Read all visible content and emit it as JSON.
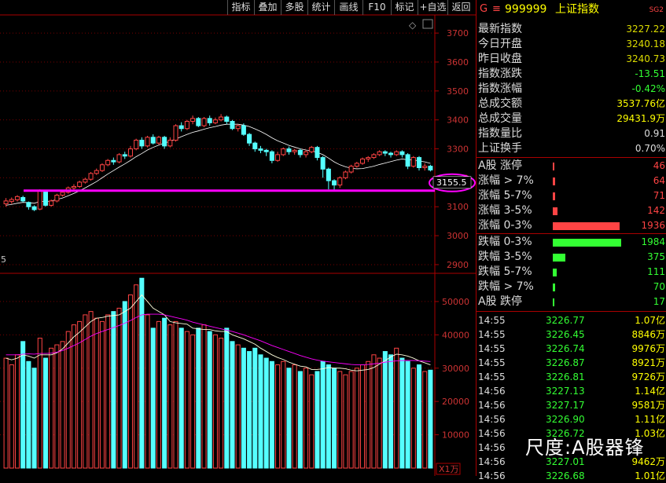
{
  "toolbar": {
    "items": [
      "指标",
      "叠加",
      "多股",
      "统计",
      "画线",
      "F10",
      "标记",
      "+自选",
      "返回"
    ]
  },
  "header": {
    "g_label": "G",
    "menu_icon": "≡",
    "code": "999999",
    "name": "上证指数",
    "badge": "SG2"
  },
  "quote": [
    {
      "label": "最新指数",
      "value": "3227.22",
      "color": "#dd0"
    },
    {
      "label": "今日开盘",
      "value": "3240.18",
      "color": "#dd0"
    },
    {
      "label": "昨日收盘",
      "value": "3240.73",
      "color": "#dd0"
    },
    {
      "label": "指数涨跌",
      "value": "-13.51",
      "color": "#3f3"
    },
    {
      "label": "指数涨幅",
      "value": "-0.42%",
      "color": "#3f3"
    },
    {
      "label": "总成交额",
      "value": "3537.76亿",
      "color": "#ff0"
    },
    {
      "label": "总成交量",
      "value": "29431.9万",
      "color": "#ff0"
    },
    {
      "label": "指数量比",
      "value": "0.91",
      "color": "#ddd"
    },
    {
      "label": "上证换手",
      "value": "0.70%",
      "color": "#ddd"
    }
  ],
  "counts": [
    {
      "label": "A股 涨停",
      "value": "46",
      "frac": 0.012,
      "color": "#f44"
    },
    {
      "label": "涨幅 > 7%",
      "value": "64",
      "frac": 0.016,
      "color": "#f44"
    },
    {
      "label": "涨幅 5-7%",
      "value": "71",
      "frac": 0.018,
      "color": "#f44"
    },
    {
      "label": "涨幅 3-5%",
      "value": "142",
      "frac": 0.036,
      "color": "#f44"
    },
    {
      "label": "涨幅 0-3%",
      "value": "1936",
      "frac": 0.5,
      "color": "#f44"
    },
    {
      "label": "跌幅 0-3%",
      "value": "1984",
      "frac": 0.51,
      "color": "#3f3"
    },
    {
      "label": "跌幅 3-5%",
      "value": "375",
      "frac": 0.096,
      "color": "#3f3"
    },
    {
      "label": "跌幅 5-7%",
      "value": "111",
      "frac": 0.029,
      "color": "#3f3"
    },
    {
      "label": "跌幅 > 7%",
      "value": "70",
      "frac": 0.018,
      "color": "#3f3"
    },
    {
      "label": "A股 跌停",
      "value": "17",
      "frac": 0.004,
      "color": "#3f3"
    }
  ],
  "ticks": [
    {
      "time": "14:55",
      "price": "3226.77",
      "vol": "1.07亿"
    },
    {
      "time": "14:55",
      "price": "3226.45",
      "vol": "8846万"
    },
    {
      "time": "14:55",
      "price": "3226.74",
      "vol": "9976万"
    },
    {
      "time": "14:55",
      "price": "3226.87",
      "vol": "8921万"
    },
    {
      "time": "14:55",
      "price": "3226.81",
      "vol": "9726万"
    },
    {
      "time": "14:56",
      "price": "3227.13",
      "vol": "1.14亿"
    },
    {
      "time": "14:56",
      "price": "3227.17",
      "vol": "9581万"
    },
    {
      "time": "14:56",
      "price": "3226.90",
      "vol": "1.11亿"
    },
    {
      "time": "14:56",
      "price": "3226.72",
      "vol": "1.03亿"
    },
    {
      "time": "14:56",
      "price": "",
      "vol": ""
    },
    {
      "time": "14:56",
      "price": "3227.01",
      "vol": "9462万"
    },
    {
      "time": "14:56",
      "price": "3226.68",
      "vol": "1.01亿"
    }
  ],
  "watermark": "尺度:A股器锋",
  "chart_data": {
    "type": "candlestick",
    "price_axis": {
      "ticks": [
        "3700",
        "3600",
        "3500",
        "3400",
        "3300",
        "3200",
        "3100",
        "3000",
        "2900"
      ],
      "ylim": [
        2870,
        3760
      ]
    },
    "volume_axis": {
      "ticks": [
        "50000",
        "40000",
        "30000",
        "20000",
        "10000"
      ],
      "ylim": [
        0,
        58000
      ],
      "unit_label": "X1万"
    },
    "horizontal_line": {
      "value": 3155.5,
      "label": "3155.5",
      "color": "#ff00ff"
    },
    "left_label": "5",
    "candles": [
      [
        3110,
        3120,
        3100,
        3130
      ],
      [
        3118,
        3125,
        3110,
        3132
      ],
      [
        3124,
        3135,
        3118,
        3140
      ],
      [
        3132,
        3120,
        3115,
        3138
      ],
      [
        3115,
        3100,
        3090,
        3118
      ],
      [
        3100,
        3090,
        3085,
        3105
      ],
      [
        3092,
        3155,
        3088,
        3160
      ],
      [
        3152,
        3105,
        3100,
        3158
      ],
      [
        3105,
        3120,
        3100,
        3125
      ],
      [
        3120,
        3140,
        3115,
        3145
      ],
      [
        3140,
        3150,
        3135,
        3155
      ],
      [
        3150,
        3165,
        3145,
        3170
      ],
      [
        3165,
        3170,
        3155,
        3178
      ],
      [
        3170,
        3185,
        3165,
        3190
      ],
      [
        3185,
        3195,
        3180,
        3200
      ],
      [
        3195,
        3215,
        3190,
        3220
      ],
      [
        3215,
        3225,
        3210,
        3232
      ],
      [
        3225,
        3245,
        3220,
        3250
      ],
      [
        3245,
        3260,
        3240,
        3265
      ],
      [
        3260,
        3255,
        3245,
        3270
      ],
      [
        3255,
        3280,
        3250,
        3285
      ],
      [
        3280,
        3275,
        3265,
        3290
      ],
      [
        3275,
        3300,
        3270,
        3310
      ],
      [
        3300,
        3330,
        3295,
        3335
      ],
      [
        3330,
        3310,
        3300,
        3340
      ],
      [
        3310,
        3340,
        3305,
        3345
      ],
      [
        3340,
        3320,
        3315,
        3350
      ],
      [
        3320,
        3340,
        3315,
        3345
      ],
      [
        3340,
        3310,
        3300,
        3345
      ],
      [
        3310,
        3330,
        3305,
        3340
      ],
      [
        3330,
        3380,
        3325,
        3385
      ],
      [
        3380,
        3370,
        3360,
        3392
      ],
      [
        3370,
        3395,
        3365,
        3400
      ],
      [
        3395,
        3405,
        3385,
        3415
      ],
      [
        3405,
        3380,
        3375,
        3410
      ],
      [
        3380,
        3405,
        3375,
        3410
      ],
      [
        3405,
        3390,
        3380,
        3415
      ],
      [
        3390,
        3400,
        3385,
        3408
      ],
      [
        3400,
        3410,
        3395,
        3420
      ],
      [
        3410,
        3395,
        3385,
        3415
      ],
      [
        3395,
        3370,
        3365,
        3400
      ],
      [
        3370,
        3380,
        3360,
        3385
      ],
      [
        3380,
        3350,
        3345,
        3388
      ],
      [
        3350,
        3320,
        3310,
        3355
      ],
      [
        3320,
        3300,
        3290,
        3325
      ],
      [
        3300,
        3295,
        3285,
        3310
      ],
      [
        3295,
        3290,
        3275,
        3300
      ],
      [
        3290,
        3260,
        3250,
        3295
      ],
      [
        3260,
        3280,
        3255,
        3290
      ],
      [
        3280,
        3300,
        3275,
        3305
      ],
      [
        3300,
        3290,
        3280,
        3308
      ],
      [
        3290,
        3295,
        3280,
        3300
      ],
      [
        3295,
        3280,
        3270,
        3300
      ],
      [
        3280,
        3290,
        3270,
        3295
      ],
      [
        3290,
        3305,
        3285,
        3310
      ],
      [
        3305,
        3270,
        3260,
        3310
      ],
      [
        3270,
        3230,
        3200,
        3275
      ],
      [
        3230,
        3190,
        3160,
        3235
      ],
      [
        3190,
        3175,
        3155,
        3195
      ],
      [
        3175,
        3200,
        3165,
        3205
      ],
      [
        3200,
        3220,
        3195,
        3225
      ],
      [
        3220,
        3240,
        3215,
        3245
      ],
      [
        3240,
        3250,
        3235,
        3255
      ],
      [
        3250,
        3265,
        3245,
        3270
      ],
      [
        3265,
        3270,
        3255,
        3275
      ],
      [
        3270,
        3280,
        3265,
        3285
      ],
      [
        3280,
        3290,
        3275,
        3295
      ],
      [
        3290,
        3285,
        3275,
        3295
      ],
      [
        3285,
        3280,
        3270,
        3290
      ],
      [
        3280,
        3290,
        3275,
        3295
      ],
      [
        3290,
        3280,
        3270,
        3295
      ],
      [
        3280,
        3240,
        3230,
        3285
      ],
      [
        3240,
        3270,
        3235,
        3275
      ],
      [
        3270,
        3235,
        3225,
        3275
      ],
      [
        3235,
        3240,
        3225,
        3250
      ],
      [
        3240,
        3227,
        3222,
        3245
      ]
    ],
    "volumes": [
      33000,
      31000,
      34000,
      38000,
      32000,
      30000,
      39000,
      33000,
      36000,
      37000,
      38000,
      41000,
      43000,
      44000,
      46000,
      47000,
      45000,
      44000,
      46000,
      47000,
      48000,
      50000,
      52000,
      55000,
      57000,
      46000,
      42000,
      44000,
      45000,
      43000,
      44000,
      42000,
      41000,
      40000,
      42000,
      43000,
      41000,
      40000,
      39000,
      42000,
      38000,
      37000,
      36000,
      35000,
      36000,
      34000,
      33000,
      32000,
      31000,
      32000,
      30000,
      31000,
      29000,
      30000,
      28000,
      29000,
      32000,
      31000,
      30000,
      29000,
      28000,
      29000,
      30000,
      31000,
      32000,
      34000,
      33000,
      35000,
      34000,
      36000,
      33000,
      32000,
      30000,
      31000,
      29000,
      29400
    ],
    "ma_price": [
      3105,
      3108,
      3112,
      3115,
      3114,
      3112,
      3118,
      3118,
      3120,
      3125,
      3130,
      3138,
      3146,
      3155,
      3165,
      3176,
      3187,
      3200,
      3213,
      3225,
      3237,
      3248,
      3260,
      3273,
      3284,
      3296,
      3305,
      3313,
      3320,
      3326,
      3334,
      3342,
      3350,
      3357,
      3362,
      3368,
      3373,
      3377,
      3382,
      3385,
      3385,
      3385,
      3382,
      3377,
      3369,
      3360,
      3350,
      3338,
      3328,
      3320,
      3312,
      3306,
      3300,
      3296,
      3293,
      3288,
      3280,
      3268,
      3255,
      3245,
      3238,
      3233,
      3231,
      3232,
      3236,
      3240,
      3246,
      3251,
      3256,
      3261,
      3265,
      3262,
      3262,
      3258,
      3255,
      3250
    ],
    "ma_vol_fast": [
      33000,
      32500,
      33000,
      34000,
      33600,
      33000,
      34000,
      34000,
      34000,
      34600,
      35800,
      37600,
      39400,
      40800,
      42400,
      44000,
      45000,
      45200,
      45600,
      45800,
      46000,
      47000,
      48000,
      50000,
      52000,
      50000,
      48000,
      47000,
      46000,
      44000,
      43600,
      43400,
      43200,
      42000,
      41800,
      41600,
      41600,
      41200,
      41000,
      41000,
      40000,
      39400,
      38800,
      38000,
      37200,
      36000,
      35000,
      34000,
      33200,
      32600,
      31800,
      31200,
      30600,
      30400,
      29600,
      29600,
      29800,
      30200,
      30000,
      30000,
      29800,
      29400,
      29200,
      29400,
      29600,
      30200,
      31200,
      32200,
      33400,
      34200,
      34000,
      33600,
      33000,
      32200,
      31600,
      31000
    ],
    "ma_vol_slow": [
      34000,
      34000,
      34000,
      34200,
      34300,
      34200,
      34400,
      34400,
      34500,
      34800,
      35300,
      36000,
      36800,
      37600,
      38600,
      39600,
      40400,
      41000,
      41600,
      42200,
      42800,
      43500,
      44300,
      45200,
      46000,
      46200,
      46200,
      46200,
      46000,
      45600,
      45200,
      44800,
      44400,
      43800,
      43400,
      43000,
      42600,
      42200,
      41800,
      41400,
      41000,
      40500,
      40000,
      39400,
      38800,
      38200,
      37500,
      36800,
      36200,
      35600,
      35000,
      34400,
      33800,
      33300,
      32800,
      32400,
      32100,
      31900,
      31700,
      31500,
      31300,
      31100,
      31000,
      31000,
      31100,
      31300,
      31500,
      31800,
      32000,
      32200,
      32300,
      32300,
      32300,
      32200,
      32100,
      32000
    ]
  }
}
